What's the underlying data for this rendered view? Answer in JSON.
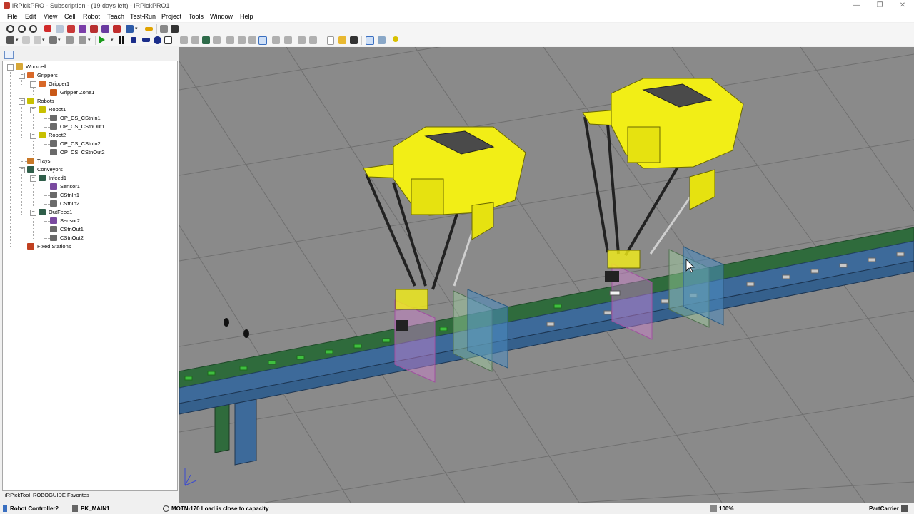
{
  "window": {
    "title": "iRPickPRO - Subscription - (19 days left) - iRPickPRO1"
  },
  "menu": [
    "File",
    "Edit",
    "View",
    "Cell",
    "Robot",
    "Teach",
    "Test-Run",
    "Project",
    "Tools",
    "Window",
    "Help"
  ],
  "tree": {
    "nodes": [
      {
        "label": "Workcell",
        "icon": "workcell-icon"
      },
      {
        "label": "Grippers",
        "icon": "grippers-icon"
      },
      {
        "label": "Gripper1",
        "icon": "gripper-icon"
      },
      {
        "label": "Gripper Zone1",
        "icon": "gripper-zone-icon"
      },
      {
        "label": "Robots",
        "icon": "robots-icon"
      },
      {
        "label": "Robot1",
        "icon": "robot-icon"
      },
      {
        "label": "OP_CS_CStnIn1",
        "icon": "coordinate-system-icon"
      },
      {
        "label": "OP_CS_CStnOut1",
        "icon": "coordinate-system-icon"
      },
      {
        "label": "Robot2",
        "icon": "robot-icon"
      },
      {
        "label": "OP_CS_CStnIn2",
        "icon": "coordinate-system-icon"
      },
      {
        "label": "OP_CS_CStnOut2",
        "icon": "coordinate-system-icon"
      },
      {
        "label": "Trays",
        "icon": "trays-icon"
      },
      {
        "label": "Conveyors",
        "icon": "conveyors-icon"
      },
      {
        "label": "Infeed1",
        "icon": "conveyor-icon"
      },
      {
        "label": "Sensor1",
        "icon": "sensor-icon"
      },
      {
        "label": "CStnIn1",
        "icon": "coordinate-system-icon"
      },
      {
        "label": "CStnIn2",
        "icon": "coordinate-system-icon"
      },
      {
        "label": "OutFeed1",
        "icon": "conveyor-icon"
      },
      {
        "label": "Sensor2",
        "icon": "sensor-icon"
      },
      {
        "label": "CStnOut1",
        "icon": "coordinate-system-icon"
      },
      {
        "label": "CStnOut2",
        "icon": "coordinate-system-icon"
      },
      {
        "label": "Fixed Stations",
        "icon": "fixed-stations-icon"
      }
    ]
  },
  "panel_tabs": [
    "iRPickTool",
    "ROBOGUIDE",
    "Favorites"
  ],
  "status": {
    "controller": "Robot Controller2",
    "program": "PK_MAIN1",
    "message": "MOTN-170 Load is close to capacity",
    "zoom": "100%",
    "right_label": "PartCarrier"
  },
  "colors": {
    "robot": "#f2ee16",
    "floor": "#8a8a8a",
    "conveyor_belt_green": "#2f6b3c",
    "conveyor_belt_blue": "#3d6a9a",
    "accent": "#0078d7"
  }
}
